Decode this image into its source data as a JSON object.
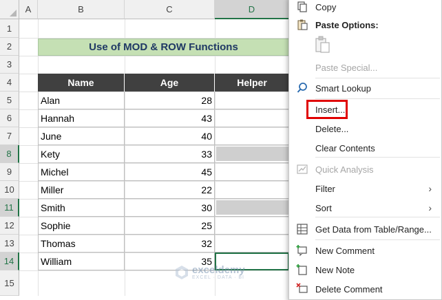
{
  "columns": [
    "A",
    "B",
    "C",
    "D"
  ],
  "row_numbers": [
    "1",
    "2",
    "3",
    "4",
    "5",
    "6",
    "7",
    "8",
    "9",
    "10",
    "11",
    "12",
    "13",
    "14",
    "15"
  ],
  "table": {
    "title": "Use of MOD & ROW Functions",
    "headers": [
      "Name",
      "Age",
      "Helper"
    ],
    "rows": [
      {
        "name": "Alan",
        "age": "28"
      },
      {
        "name": "Hannah",
        "age": "43"
      },
      {
        "name": "June",
        "age": "40"
      },
      {
        "name": "Kety",
        "age": "33"
      },
      {
        "name": "Michel",
        "age": "45"
      },
      {
        "name": "Miller",
        "age": "22"
      },
      {
        "name": "Smith",
        "age": "30"
      },
      {
        "name": "Sophie",
        "age": "25"
      },
      {
        "name": "Thomas",
        "age": "32"
      },
      {
        "name": "William",
        "age": "35"
      }
    ]
  },
  "watermark": {
    "brand": "exceldemy",
    "tagline": "EXCEL · DATA · BI"
  },
  "context_menu": {
    "copy": "Copy",
    "paste_options": "Paste Options:",
    "paste_special": "Paste Special...",
    "smart_lookup": "Smart Lookup",
    "insert": "Insert...",
    "delete": "Delete...",
    "clear_contents": "Clear Contents",
    "quick_analysis": "Quick Analysis",
    "filter": "Filter",
    "sort": "Sort",
    "get_data": "Get Data from Table/Range...",
    "new_comment": "New Comment",
    "new_note": "New Note",
    "delete_comment": "Delete Comment",
    "submenu_arrow": "›"
  },
  "colors": {
    "excel_green": "#217346",
    "highlight_red": "#e00000",
    "header_dark": "#404040",
    "title_green": "#c5e0b4"
  }
}
